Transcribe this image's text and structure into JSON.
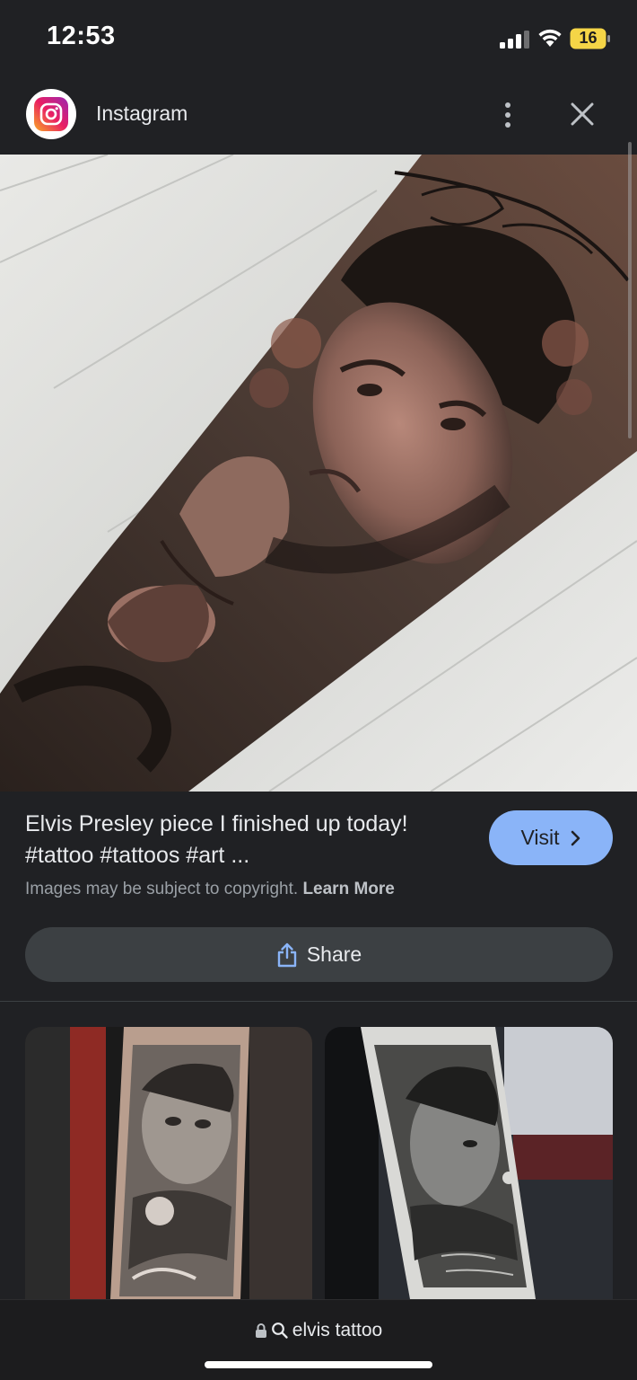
{
  "status_bar": {
    "time": "12:53",
    "battery": "16"
  },
  "header": {
    "site_name": "Instagram",
    "logo_icon": "instagram-icon",
    "more_icon": "more-vertical-icon",
    "close_icon": "close-icon"
  },
  "result": {
    "title": "Elvis Presley piece I finished up today! #tattoo #tattoos #art ...",
    "copyright_text": "Images may be subject to copyright.",
    "learn_more": "Learn More",
    "visit_label": "Visit",
    "share_label": "Share"
  },
  "bottom_bar": {
    "query": "elvis tattoo"
  },
  "colors": {
    "background": "#202124",
    "accent": "#8ab4f8",
    "button_surface": "#3c4043",
    "battery_fill": "#f5d547"
  }
}
